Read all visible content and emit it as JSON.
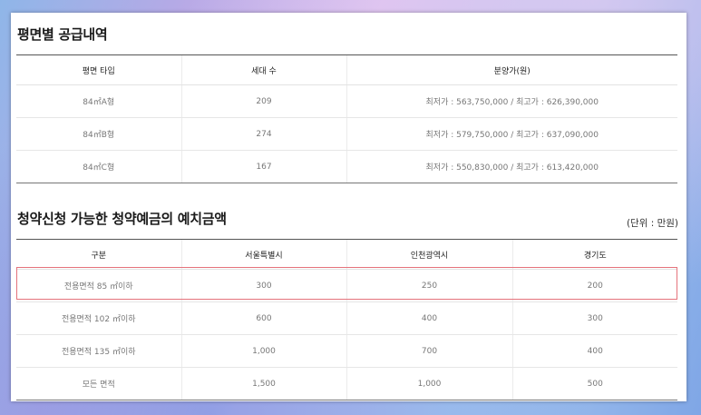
{
  "supply_section": {
    "title": "평면별 공급내역",
    "headers": [
      "평면 타입",
      "세대 수",
      "분양가(원)"
    ],
    "rows": [
      [
        "84㎡A형",
        "209",
        "최저가 : 563,750,000 / 최고가 : 626,390,000"
      ],
      [
        "84㎡B형",
        "274",
        "최저가 : 579,750,000 / 최고가 : 637,090,000"
      ],
      [
        "84㎡C형",
        "167",
        "최저가 : 550,830,000 / 최고가 : 613,420,000"
      ]
    ]
  },
  "deposit_section": {
    "title": "청약신청 가능한 청약예금의 예치금액",
    "unit_note": "(단위 : 만원)",
    "headers": [
      "구분",
      "서울특별시",
      "인천광역시",
      "경기도"
    ],
    "rows": [
      [
        "전용면적 85 ㎡이하",
        "300",
        "250",
        "200"
      ],
      [
        "전용면적 102 ㎡이하",
        "600",
        "400",
        "300"
      ],
      [
        "전용면적 135 ㎡이하",
        "1,000",
        "700",
        "400"
      ],
      [
        "모든 면적",
        "1,500",
        "1,000",
        "500"
      ]
    ],
    "highlighted_row": 0
  },
  "colors": {
    "highlight_border": "#e5737c",
    "header_rule": "#555555",
    "cell_text": "#777777"
  }
}
